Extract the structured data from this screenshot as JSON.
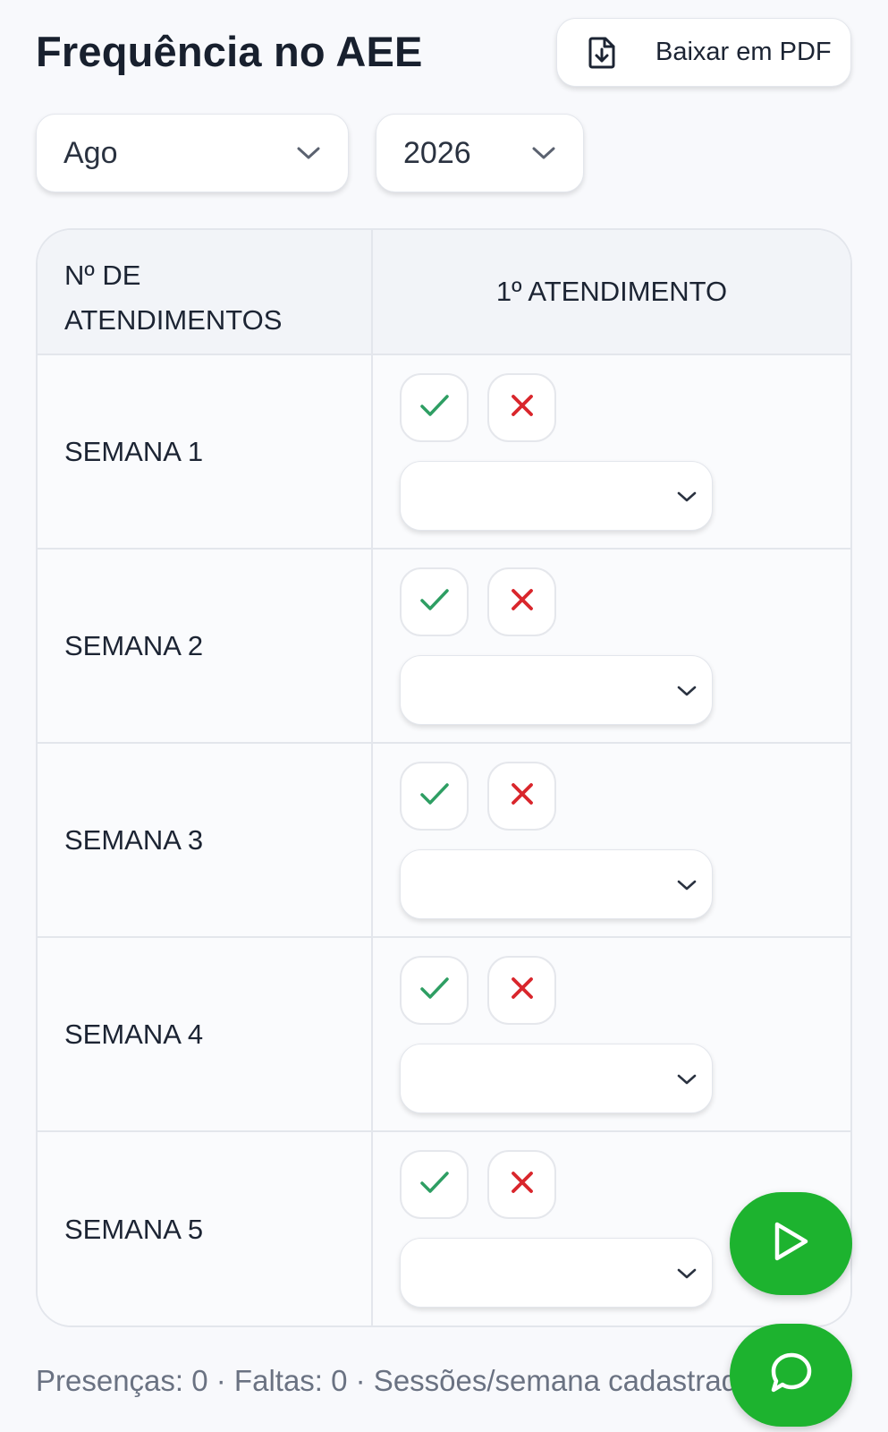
{
  "header": {
    "title": "Frequência no AEE",
    "pdf_button_label": "Baixar em PDF"
  },
  "filters": {
    "month": "Ago",
    "year": "2026"
  },
  "table": {
    "col1_line1": "Nº DE",
    "col1_line2": "ATENDIMENTOS",
    "col2": "1º ATENDIMENTO",
    "rows": [
      {
        "label": "SEMANA 1",
        "selected": ""
      },
      {
        "label": "SEMANA 2",
        "selected": ""
      },
      {
        "label": "SEMANA 3",
        "selected": ""
      },
      {
        "label": "SEMANA 4",
        "selected": ""
      },
      {
        "label": "SEMANA 5",
        "selected": ""
      }
    ]
  },
  "footer": {
    "summary": "Presenças: 0 · Faltas: 0 · Sessões/semana cadastradas"
  },
  "icons": {
    "pdf": "file-download-icon",
    "chevron": "chevron-down-icon",
    "present": "check-icon",
    "absent": "x-icon",
    "play": "play-icon",
    "chat": "chat-bubble-icon"
  },
  "colors": {
    "check": "#2e9e63",
    "cross": "#d9262c",
    "fab": "#1db32f"
  }
}
